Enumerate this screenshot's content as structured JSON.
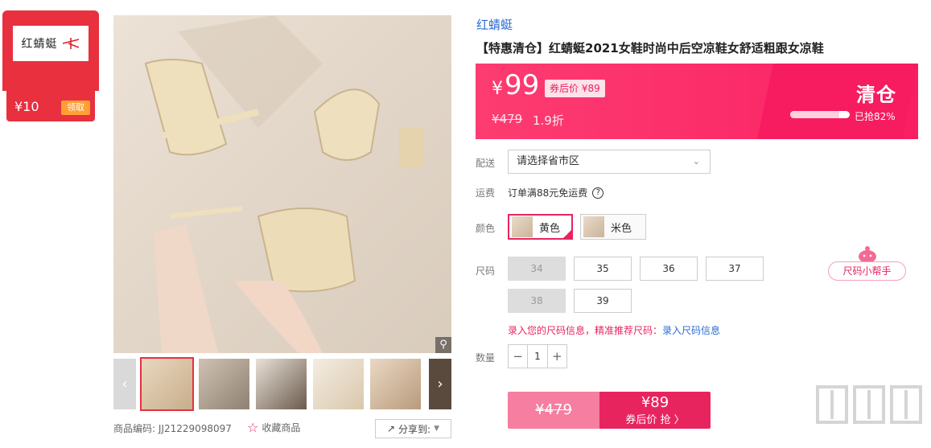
{
  "coupon": {
    "logo_text": "红蜻蜓",
    "amount": "¥10",
    "button": "领取"
  },
  "gallery": {
    "zoom_icon": "magnifier-icon",
    "prev_icon": "chevron-left-icon",
    "next_icon": "chevron-right-icon",
    "product_code_label": "商品编码:",
    "product_code": "JJ21229098097",
    "collect_label": "收藏商品",
    "share_label": "分享到:"
  },
  "product": {
    "brand": "红蜻蜓",
    "title": "【特惠清仓】红蜻蜓2021女鞋时尚中后空凉鞋女舒适粗跟女凉鞋"
  },
  "price": {
    "currency": "¥",
    "current": "99",
    "after_coupon_tag": "券后价 ¥89",
    "original": "¥479",
    "discount": "1.9折",
    "clearance": "清仓",
    "sold_progress": 0.82,
    "sold_text": "已抢82%"
  },
  "delivery": {
    "label": "配送",
    "placeholder": "请选择省市区"
  },
  "shipping": {
    "label": "运费",
    "text": "订单满88元免运费"
  },
  "colors": {
    "label": "颜色",
    "options": [
      {
        "name": "黄色",
        "selected": true
      },
      {
        "name": "米色",
        "selected": false
      }
    ]
  },
  "sizes": {
    "label": "尺码",
    "options": [
      {
        "size": "34",
        "disabled": true
      },
      {
        "size": "35",
        "disabled": false
      },
      {
        "size": "36",
        "disabled": false
      },
      {
        "size": "37",
        "disabled": false
      },
      {
        "size": "38",
        "disabled": true
      },
      {
        "size": "39",
        "disabled": false
      }
    ],
    "helper": "尺码小帮手",
    "info_text": "录入您的尺码信息，精准推荐尺码：",
    "info_link": "录入尺码信息"
  },
  "quantity": {
    "label": "数量",
    "value": "1",
    "minus": "−",
    "plus": "+"
  },
  "buy": {
    "original": "¥479",
    "price": "¥89",
    "action": "券后价 抢 〉"
  },
  "colors_theme": {
    "accent": "#e8245f",
    "brand_red": "#e8303f",
    "link": "#2b6cd8"
  }
}
